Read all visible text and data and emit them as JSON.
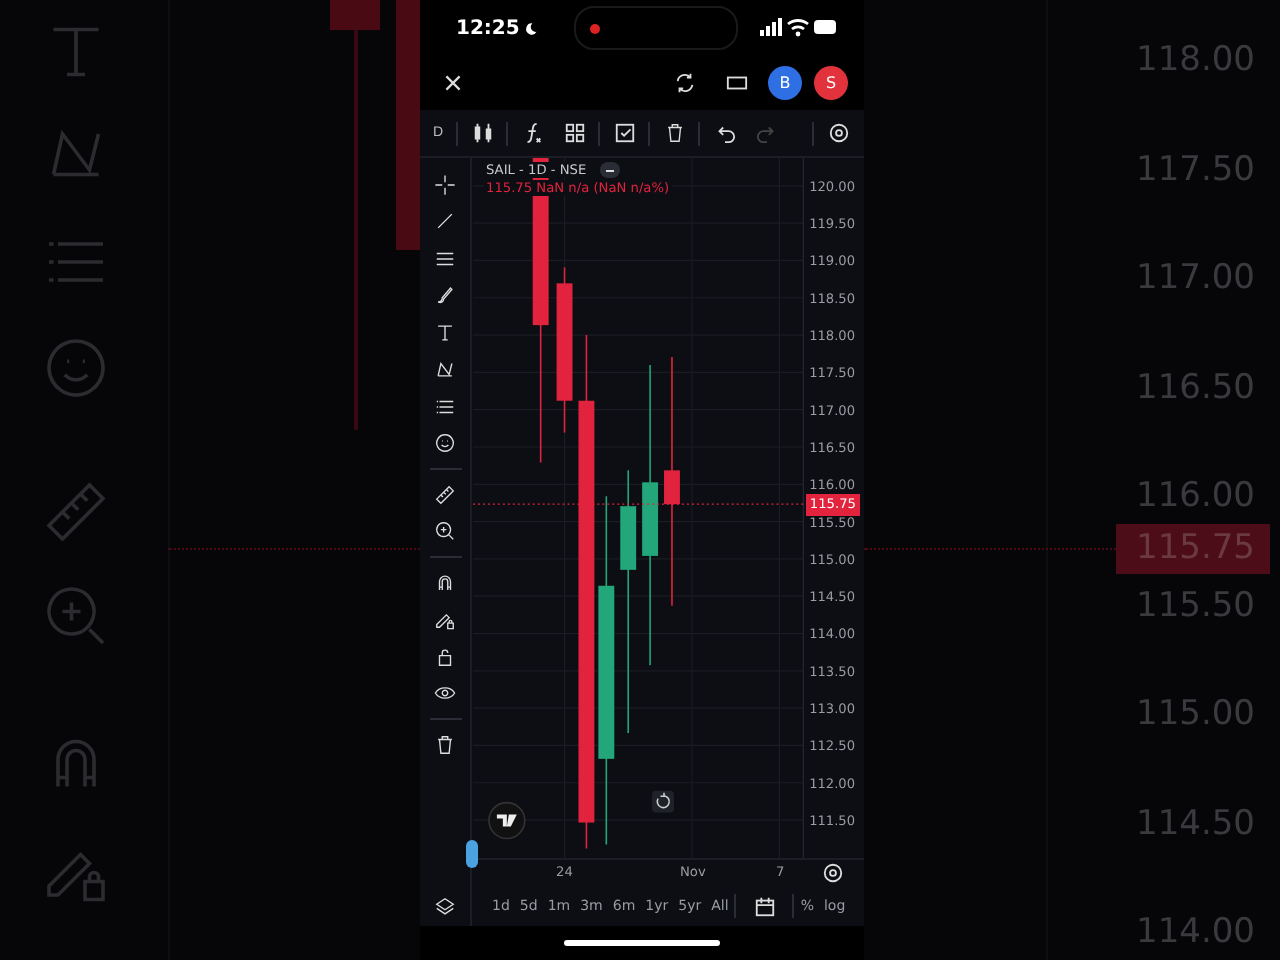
{
  "status_bar": {
    "time": "12:25"
  },
  "header": {
    "avatars": [
      {
        "label": "B",
        "color": "#2f6fe4"
      },
      {
        "label": "S",
        "color": "#e2333d"
      }
    ]
  },
  "toolbar": {
    "interval": "D"
  },
  "legend": {
    "symbol": "SAIL - 1D - NSE",
    "values": "115.75 NaN n/a (NaN n/a%)"
  },
  "price_axis": {
    "labels": [
      "120.00",
      "119.50",
      "119.00",
      "118.50",
      "118.00",
      "117.50",
      "117.00",
      "116.50",
      "116.00",
      "115.50",
      "115.00",
      "114.50",
      "114.00",
      "113.50",
      "113.00",
      "112.50",
      "112.00",
      "111.50"
    ],
    "last_price": "115.75"
  },
  "time_axis": {
    "labels": [
      "24",
      "Nov",
      "7"
    ]
  },
  "ranges": [
    {
      "label": "1d"
    },
    {
      "label": "5d"
    },
    {
      "label": "1m"
    },
    {
      "label": "3m"
    },
    {
      "label": "6m"
    },
    {
      "label": "1yr"
    },
    {
      "label": "5yr"
    },
    {
      "label": "All"
    }
  ],
  "scale_options": [
    "%",
    "log"
  ],
  "backdrop": {
    "price_labels": [
      "118.00",
      "117.50",
      "117.00",
      "116.50",
      "116.00",
      "115.50",
      "115.00",
      "114.50",
      "114.00"
    ],
    "last_price": "115.75"
  }
}
